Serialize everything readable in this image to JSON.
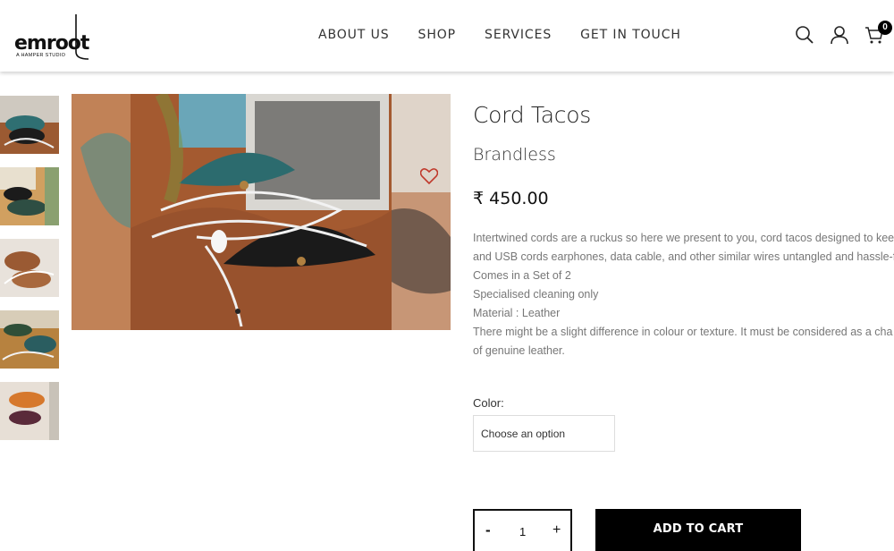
{
  "header": {
    "logo_text": "emroot",
    "logo_subtitle": "A HAMPER STUDIO",
    "nav": [
      "ABOUT US",
      "SHOP",
      "SERVICES",
      "GET IN TOUCH"
    ],
    "cart_count": "0",
    "icons": [
      "search-icon",
      "user-icon",
      "cart-icon"
    ]
  },
  "product": {
    "title": "Cord Tacos",
    "brand": "Brandless",
    "currency_symbol": "₹",
    "price": "450.00",
    "description": [
      "Intertwined cords are a ruckus so here we present to you, cord tacos designed to keep",
      "and USB cords earphones, data cable, and other similar wires untangled and hassle-fr",
      "Comes in a Set of 2",
      "Specialised cleaning only",
      "Material : Leather",
      "There might be a slight difference in colour or texture. It must be considered as a cha",
      "of genuine leather."
    ],
    "color_label": "Color:",
    "color_select_value": "Choose an option",
    "quantity": "1",
    "minus_label": "-",
    "plus_label": "+",
    "add_to_cart_label": "ADD TO CART"
  },
  "colors": {
    "accent": "#000000",
    "heart": "#c0392b",
    "text_muted": "#777777"
  }
}
